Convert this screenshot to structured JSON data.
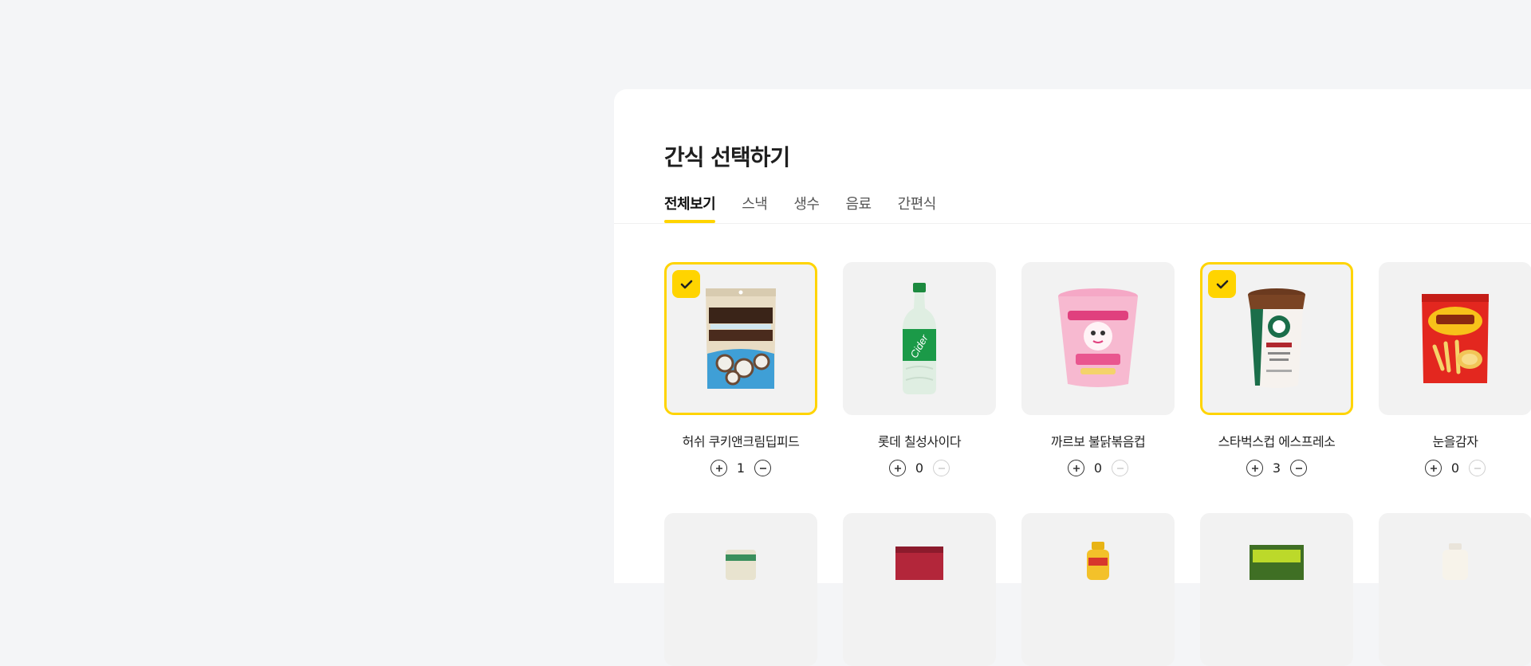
{
  "page": {
    "title": "간식 선택하기"
  },
  "tabs": [
    {
      "label": "전체보기",
      "active": true
    },
    {
      "label": "스낵",
      "active": false
    },
    {
      "label": "생수",
      "active": false
    },
    {
      "label": "음료",
      "active": false
    },
    {
      "label": "간편식",
      "active": false
    }
  ],
  "products": [
    {
      "name": "허쉬 쿠키앤크림딥피드",
      "qty": "1",
      "selected": true,
      "icon": "pretzel-bag-icon"
    },
    {
      "name": "롯데 칠성사이다",
      "qty": "0",
      "selected": false,
      "icon": "soda-bottle-icon"
    },
    {
      "name": "까르보 불닭볶음컵",
      "qty": "0",
      "selected": false,
      "icon": "noodle-cup-icon"
    },
    {
      "name": "스타벅스컵 에스프레소",
      "qty": "3",
      "selected": true,
      "icon": "coffee-cup-icon"
    },
    {
      "name": "눈을감자",
      "qty": "0",
      "selected": false,
      "icon": "potato-snack-icon"
    }
  ],
  "row2_icons": [
    "can-icon",
    "box-icon",
    "small-bottle-icon",
    "snack-box-icon",
    "milk-bottle-icon"
  ],
  "colors": {
    "accent": "#ffd400",
    "background": "#f4f5f7",
    "card": "#f2f2f2"
  }
}
